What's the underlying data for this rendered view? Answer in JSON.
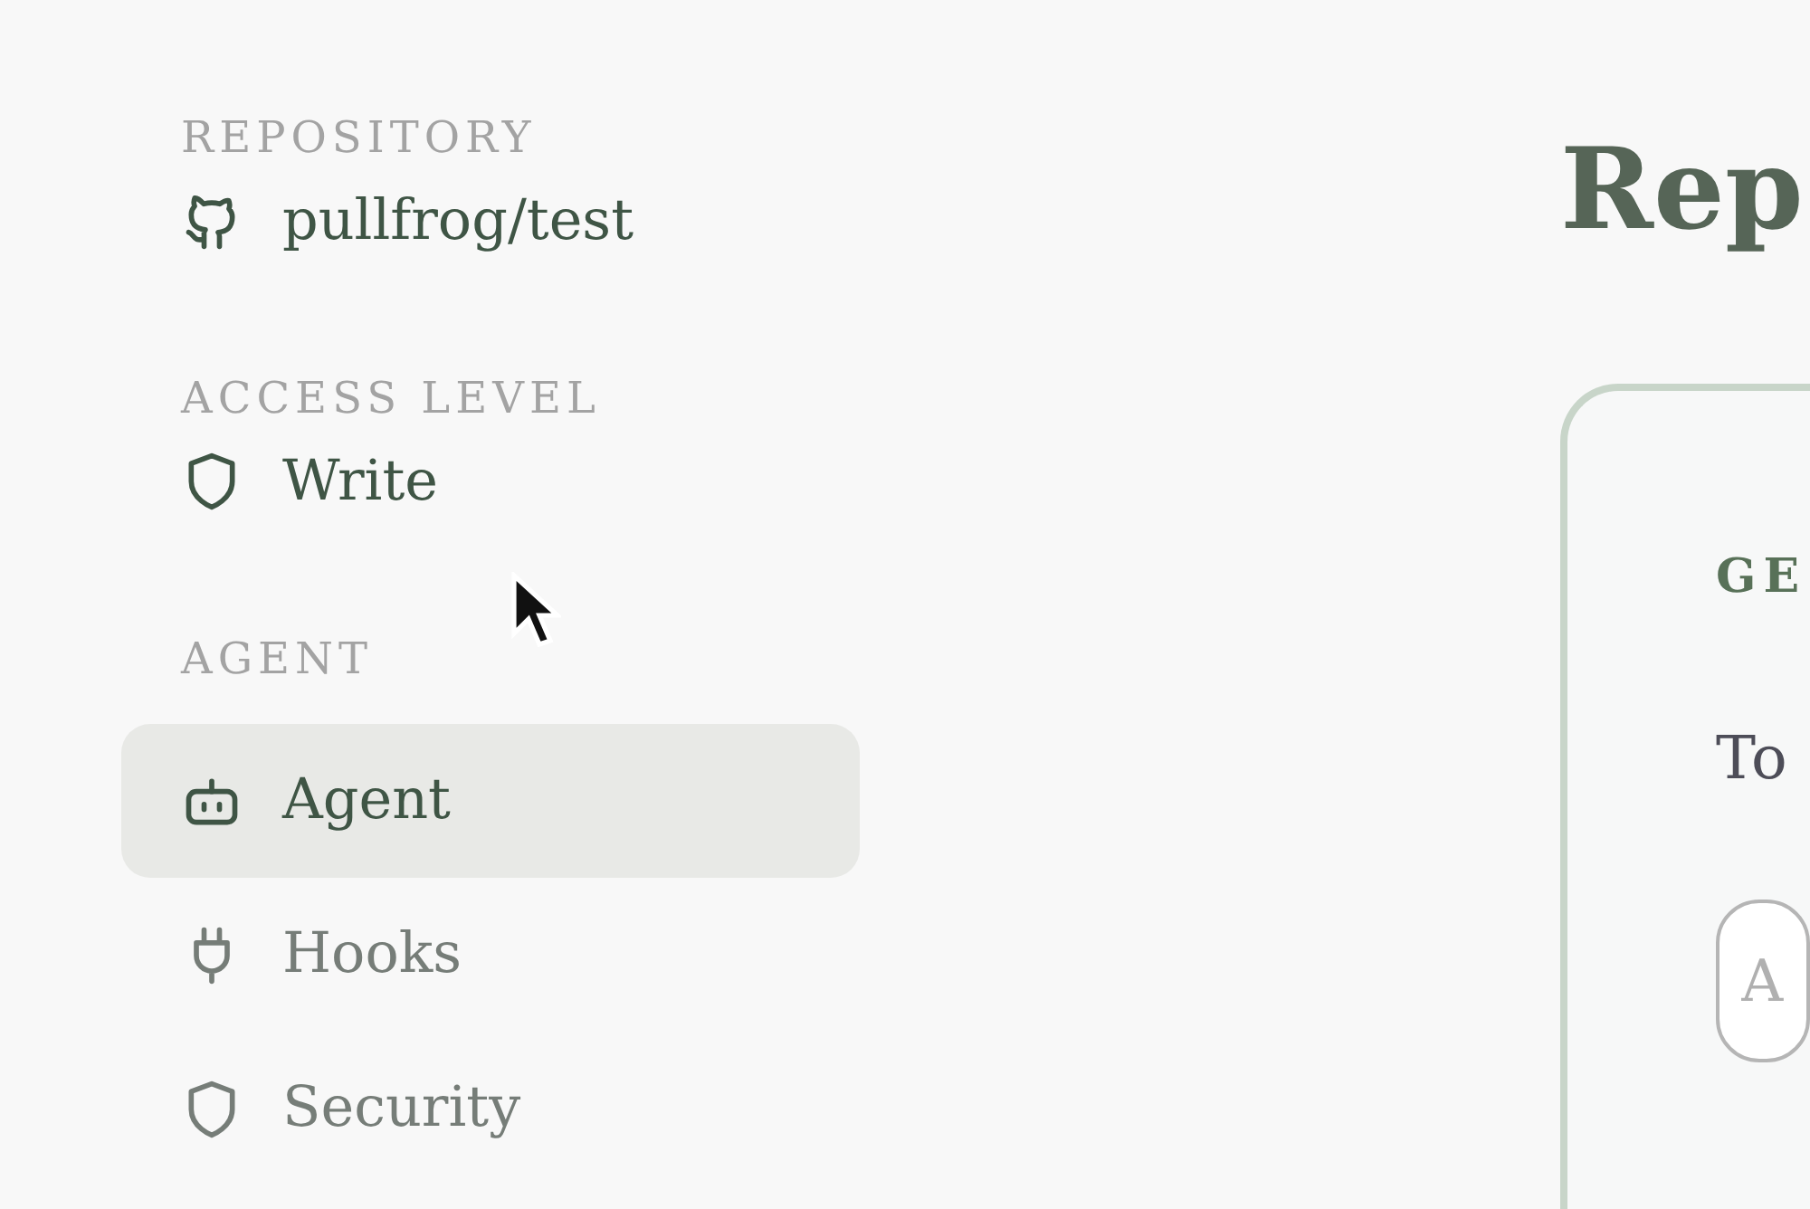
{
  "sidebar": {
    "repository": {
      "label": "REPOSITORY",
      "value": "pullfrog/test"
    },
    "access_level": {
      "label": "ACCESS LEVEL",
      "value": "Write"
    },
    "agent": {
      "label": "AGENT",
      "items": [
        {
          "label": "Agent",
          "selected": true
        },
        {
          "label": "Hooks",
          "selected": false
        },
        {
          "label": "Security",
          "selected": false
        }
      ]
    }
  },
  "main": {
    "title": "Rep",
    "card": {
      "heading": "GE",
      "text": "To",
      "input": {
        "placeholder": "A"
      }
    }
  }
}
